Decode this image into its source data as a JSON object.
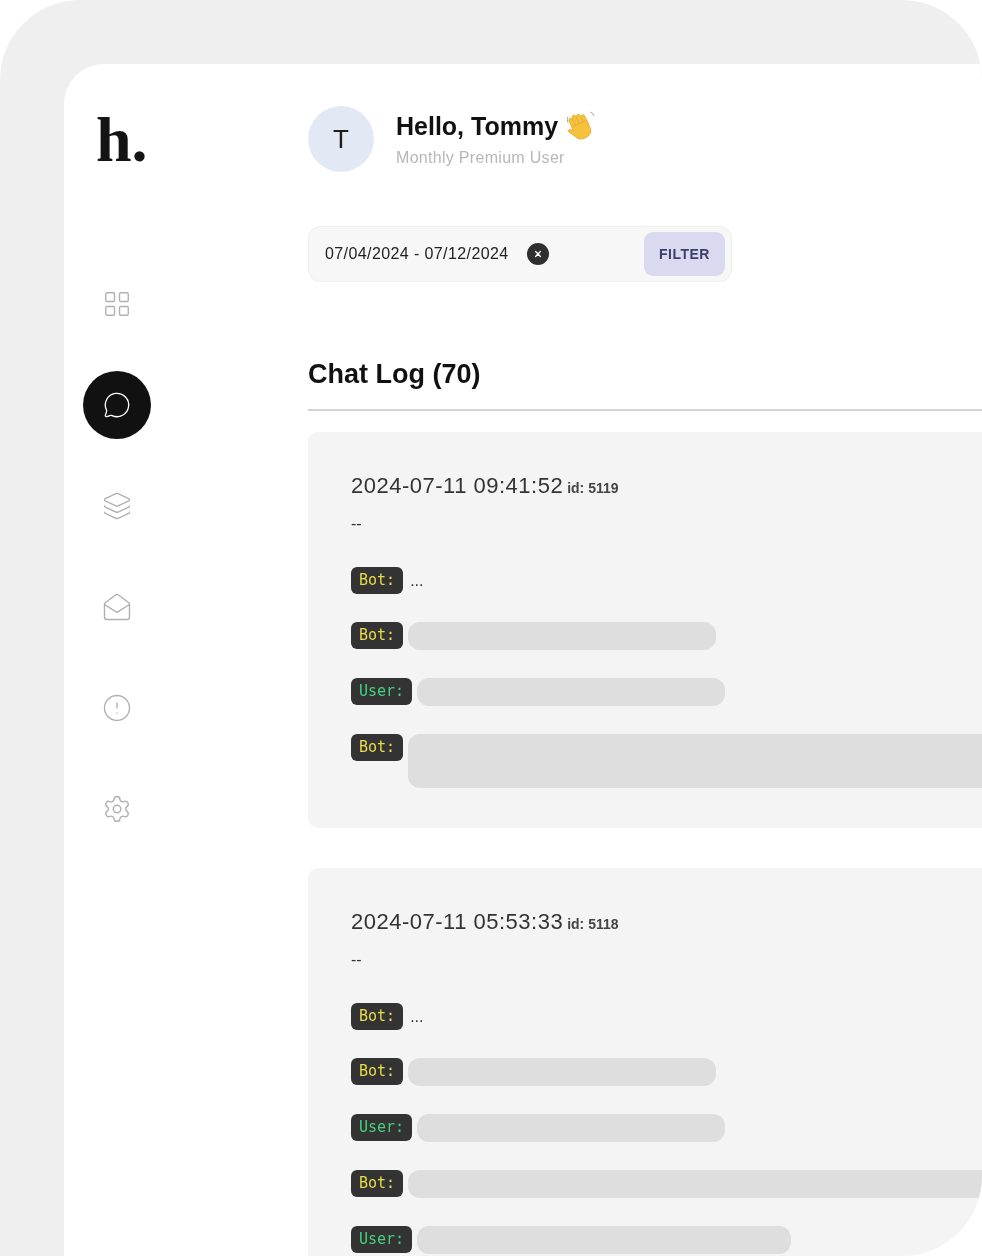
{
  "sidebar": {
    "logo": "h.",
    "items": [
      {
        "selected": false
      },
      {
        "selected": true
      },
      {
        "selected": false
      },
      {
        "selected": false
      },
      {
        "selected": false
      },
      {
        "selected": false
      }
    ]
  },
  "header": {
    "avatar": "T",
    "greeting": "Hello, Tommy",
    "subtitle": "Monthly Premium User"
  },
  "filter": {
    "date_range": "07/04/2024 - 07/12/2024",
    "button": "FILTER"
  },
  "chat_log": {
    "title": "Chat Log (70)",
    "entries": [
      {
        "timestamp": "2024-07-11 09:41:52",
        "id_text": "id: 5119",
        "summary": "--",
        "messages": [
          {
            "speaker": {
              "kind": "bot",
              "label": "Bot:"
            },
            "body": {
              "kind": "text",
              "text": "..."
            }
          },
          {
            "speaker": {
              "kind": "bot",
              "label": "Bot:"
            },
            "body": {
              "kind": "short"
            }
          },
          {
            "speaker": {
              "kind": "user",
              "label": "User:"
            },
            "body": {
              "kind": "short"
            }
          },
          {
            "speaker": {
              "kind": "bot",
              "label": "Bot:"
            },
            "body": {
              "kind": "tall"
            }
          }
        ]
      },
      {
        "timestamp": "2024-07-11 05:53:33",
        "id_text": "id: 5118",
        "summary": "--",
        "messages": [
          {
            "speaker": {
              "kind": "bot",
              "label": "Bot:"
            },
            "body": {
              "kind": "text",
              "text": "..."
            }
          },
          {
            "speaker": {
              "kind": "bot",
              "label": "Bot:"
            },
            "body": {
              "kind": "short"
            }
          },
          {
            "speaker": {
              "kind": "user",
              "label": "User:"
            },
            "body": {
              "kind": "short"
            }
          },
          {
            "speaker": {
              "kind": "bot",
              "label": "Bot:"
            },
            "body": {
              "kind": "full"
            }
          },
          {
            "speaker": {
              "kind": "user",
              "label": "User:"
            },
            "body": {
              "kind": "medium"
            }
          }
        ]
      }
    ]
  }
}
